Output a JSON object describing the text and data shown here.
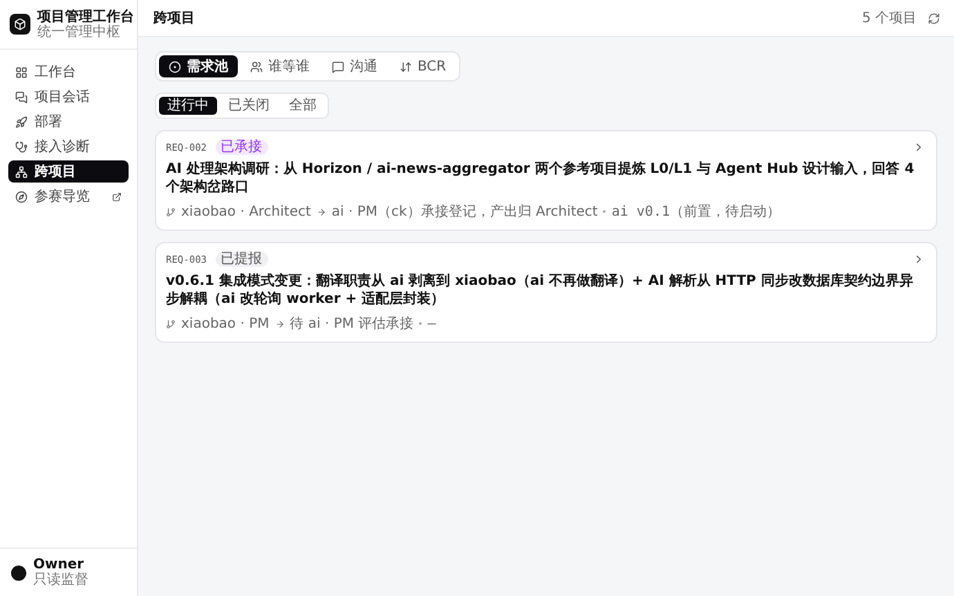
{
  "app": {
    "title": "项目管理工作台",
    "subtitle": "统一管理中枢"
  },
  "nav": [
    {
      "label": "工作台",
      "kind": "grid",
      "selected": false,
      "external": false
    },
    {
      "label": "项目会话",
      "kind": "chats",
      "selected": false,
      "external": false
    },
    {
      "label": "部署",
      "kind": "rocket",
      "selected": false,
      "external": false
    },
    {
      "label": "接入诊断",
      "kind": "stethoscope",
      "selected": false,
      "external": false
    },
    {
      "label": "跨项目",
      "kind": "network",
      "selected": true,
      "external": false
    },
    {
      "label": "参赛导览",
      "kind": "compass",
      "selected": false,
      "external": true
    }
  ],
  "user": {
    "name": "Owner",
    "role": "只读监督"
  },
  "header": {
    "title": "跨项目",
    "count": "5 个项目"
  },
  "tabs": [
    {
      "label": "需求池",
      "kind": "target",
      "selected": true
    },
    {
      "label": "谁等谁",
      "kind": "users",
      "selected": false
    },
    {
      "label": "沟通",
      "kind": "message",
      "selected": false
    },
    {
      "label": "BCR",
      "kind": "swap",
      "selected": false
    }
  ],
  "filters": [
    {
      "label": "进行中",
      "selected": true
    },
    {
      "label": "已关闭",
      "selected": false
    },
    {
      "label": "全部",
      "selected": false
    }
  ],
  "cards": [
    {
      "id": "REQ-002",
      "status": "已承接",
      "kind": "accepted",
      "title": "AI 处理架构调研：从 Horizon / ai-news-aggregator 两个参考项目提炼 L0/L1 与 Agent Hub 设计输入，回答 4 个架构岔路口",
      "from": "xiaobao · Architect",
      "to": "ai · PM（ck）承接登记，产出归 Architect",
      "version": "ai v0.1（前置，待启动）"
    },
    {
      "id": "REQ-003",
      "status": "已提报",
      "kind": "submitted",
      "title": "v0.6.1 集成模式变更：翻译职责从 ai 剥离到 xiaobao（ai 不再做翻译）+ AI 解析从 HTTP 同步改数据库契约边界异步解耦（ai 改轮询 worker + 适配层封装）",
      "from": "xiaobao · PM",
      "to": "待 ai · PM 评估承接",
      "version": "—"
    }
  ]
}
